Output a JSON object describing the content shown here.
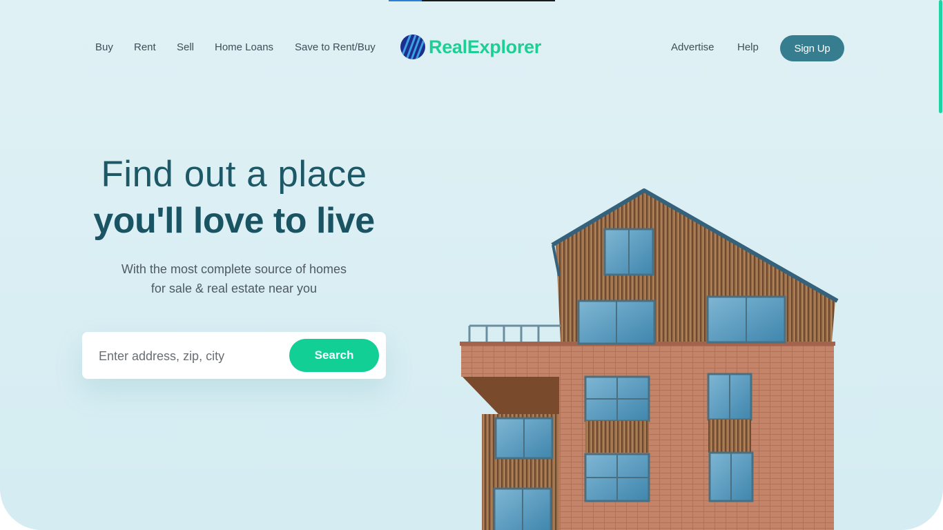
{
  "header": {
    "nav_left": [
      "Buy",
      "Rent",
      "Sell",
      "Home Loans",
      "Save to Rent/Buy"
    ],
    "brand": "RealExplorer",
    "nav_right": [
      "Advertise",
      "Help"
    ],
    "signup_label": "Sign Up"
  },
  "hero": {
    "line1": "Find out a place",
    "line2": "you'll love to live",
    "subtitle_line1": "With the most complete source of homes",
    "subtitle_line2": "for sale & real estate near you"
  },
  "search": {
    "placeholder": "Enter address, zip, city",
    "button_label": "Search"
  },
  "page_progress": 0.2,
  "colors": {
    "brand_green": "#1dcf94",
    "heading_teal": "#1a5361",
    "signup_bg": "#367d8f",
    "search_btn": "#12cf95",
    "background": "#d9eff4"
  },
  "icons": {
    "logo": "striped-globe-icon"
  }
}
